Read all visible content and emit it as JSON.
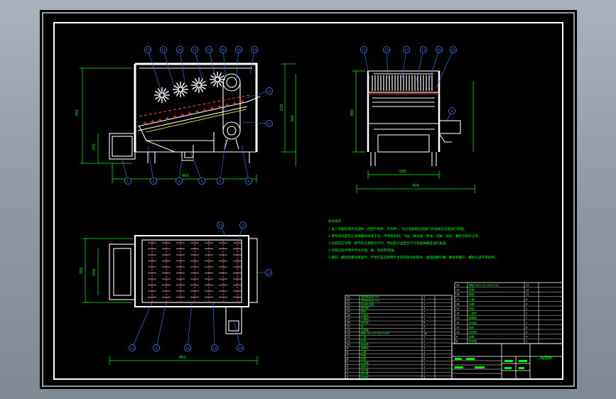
{
  "drawing": {
    "title_block_name": "二级图纸"
  },
  "front_view": {
    "balloons_top": [
      "13",
      "12",
      "20",
      "11",
      "15",
      "16",
      "18",
      "19"
    ],
    "balloons_right": [
      "14",
      "17"
    ],
    "balloons_bottom": [
      "1",
      "2",
      "3",
      "4",
      "8",
      "9"
    ],
    "dimensions": {
      "height_overall": "750",
      "height_inner": "520",
      "height_box": "370",
      "width_overall": "950",
      "right_height": "760"
    }
  },
  "side_view": {
    "balloons_top": [
      "12",
      "13",
      "17",
      "11",
      "10",
      "16"
    ],
    "balloons_right": [
      "8"
    ],
    "dimensions": {
      "height": "400",
      "width": "580",
      "base": "400"
    }
  },
  "plan_view": {
    "balloons_top": [
      "14",
      "15"
    ],
    "balloons_right": [
      "23"
    ],
    "balloons_bottom": [
      "13",
      "5",
      "16",
      "22",
      "19"
    ],
    "dimensions": {
      "width": "950",
      "depth": "700",
      "left": "550"
    }
  },
  "notes": {
    "heading": "技术要求",
    "lines": [
      "1.进入装配的零件及部件（包括外购件、外协件），均必须具有检验部门的合格证方能进行装配。",
      "2.零件在装配前必须清理和清洗干净，不得有毛刺、飞边、氧化皮、锈蚀、切屑、油污、着色剂和灰尘等。",
      "3.装配前应对零、部件的主要配合尺寸，特别是过盈配合尺寸及相关精度进行复查。",
      "4.装配过程中零件不允许磕、碰、划伤和锈蚀。",
      "5.螺钉、螺栓和螺母紧固时，严禁打击或使用不合适的旋具和扳手，紧固后螺钉槽、螺母和螺钉、螺栓头部不得损坏。"
    ]
  },
  "bom_left": {
    "rows": [
      [
        "23",
        "清洗刷总成-002",
        "1",
        ""
      ],
      [
        "22",
        "清洗刷总成-001",
        "1",
        ""
      ],
      [
        "21",
        "电动机支架",
        "1",
        ""
      ],
      [
        "20",
        "清洗刷",
        "4",
        ""
      ],
      [
        "19",
        "链条",
        "1",
        ""
      ],
      [
        "18",
        "大链轮",
        "1",
        ""
      ],
      [
        "17",
        "小链轮",
        "1",
        ""
      ],
      [
        "16",
        "轴承座",
        "8",
        ""
      ],
      [
        "15",
        "轴",
        "4",
        ""
      ],
      [
        "14",
        "喷淋管",
        "1",
        ""
      ],
      [
        "13",
        "螺栓 M8×20 GB/T5782",
        "16",
        ""
      ],
      [
        "12",
        "上盖",
        "1",
        ""
      ],
      [
        "11",
        "机架",
        "1",
        ""
      ],
      [
        "10",
        "输送带",
        "1",
        ""
      ],
      [
        "9",
        "减速机",
        "1",
        ""
      ],
      [
        "8",
        "水箱",
        "1",
        ""
      ],
      [
        "7",
        "侧板",
        "2",
        ""
      ],
      [
        "6",
        "挡板",
        "2",
        ""
      ],
      [
        "5",
        "出料槽",
        "1",
        ""
      ],
      [
        "4",
        "进料斗",
        "1",
        ""
      ],
      [
        "3",
        "排水管",
        "1",
        ""
      ],
      [
        "2",
        "接水盘",
        "1",
        ""
      ],
      [
        "1",
        "电动机",
        "1",
        ""
      ]
    ]
  },
  "bom_right": {
    "rows": [
      [
        "20",
        "螺栓 M12×30 GB/T5782",
        "12",
        ""
      ],
      [
        "19",
        "垫圈",
        "12",
        ""
      ],
      [
        "18",
        "螺母",
        "12",
        ""
      ],
      [
        "17",
        "平键",
        "4",
        ""
      ],
      [
        "16",
        "毛刷",
        "4",
        ""
      ],
      [
        "15",
        "带轮",
        "2",
        ""
      ],
      [
        "14",
        "三角带",
        "2",
        ""
      ],
      [
        "13",
        "联轴器",
        "1",
        ""
      ],
      [
        "12",
        "传动轴",
        "1",
        ""
      ],
      [
        "11",
        "轴承",
        "8",
        ""
      ],
      [
        "10",
        "密封圈",
        "4",
        ""
      ],
      [
        "9",
        "支腿",
        "4",
        ""
      ],
      [
        "8",
        "防护罩",
        "1",
        ""
      ]
    ]
  },
  "colors": {
    "border": "#ffffff",
    "geometry": "#ffffff",
    "dimension": "#00ff00",
    "balloon": "#3f7fff",
    "hidden": "#ff3b3b",
    "note": "#00ff00",
    "accent": "#ffff00"
  }
}
